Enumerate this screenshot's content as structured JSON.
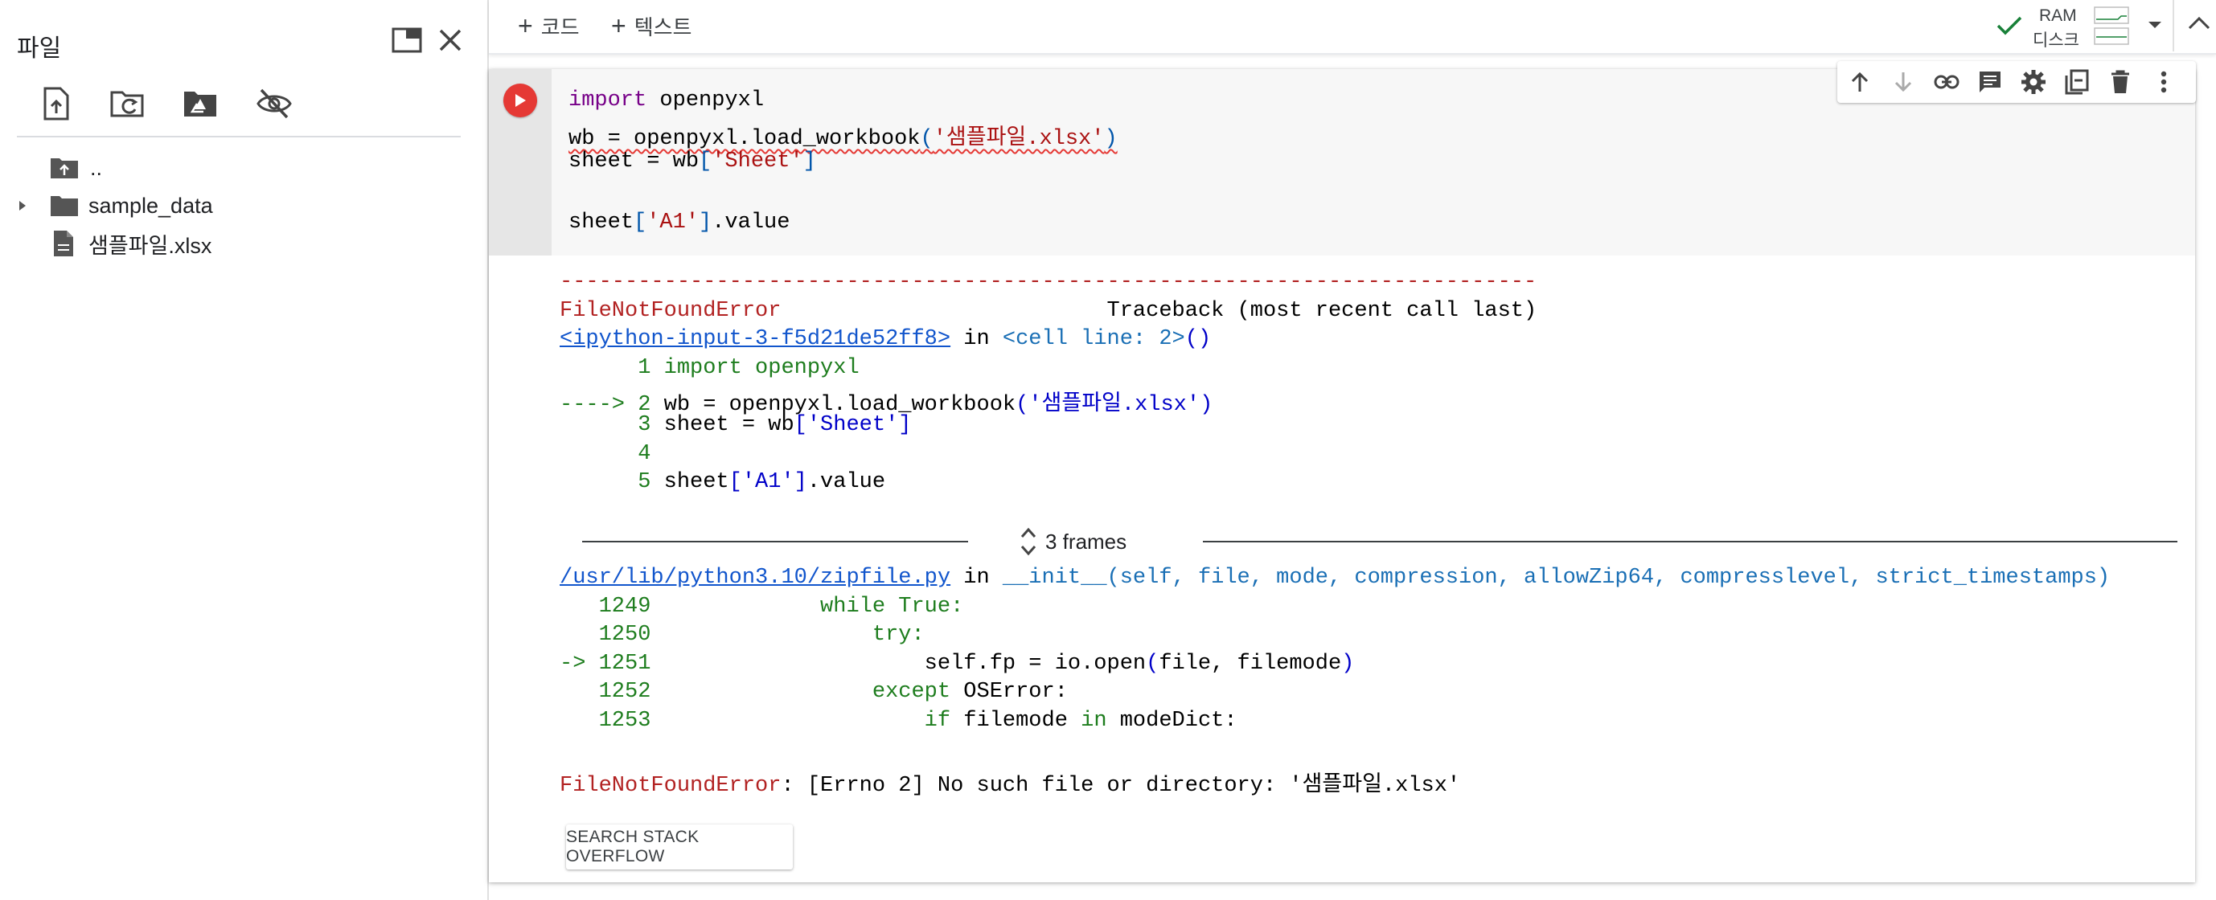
{
  "file_panel": {
    "title": "파일",
    "tree": {
      "parent": "..",
      "folder": "sample_data",
      "file": "샘플파일.xlsx"
    }
  },
  "topbar": {
    "add_code": "코드",
    "add_text": "텍스트",
    "ram_label": "RAM",
    "disk_label": "디스크"
  },
  "code": {
    "line1_kw": "import",
    "line1_rest": " openpyxl",
    "line2_a": "wb = openpyxl.load_workbook",
    "line2_b": "(",
    "line2_c": "'샘플파일.xlsx'",
    "line2_d": ")",
    "line3_a": "sheet = wb",
    "line3_b": "[",
    "line3_c": "'Sheet'",
    "line3_d": "]",
    "line5_a": "sheet",
    "line5_b": "[",
    "line5_c": "'A1'",
    "line5_d": "]",
    "line5_e": ".value"
  },
  "output": {
    "dashes": "---------------------------------------------------------------------------",
    "err_name": "FileNotFoundError",
    "traceback_header": "                         Traceback (most recent call last)",
    "input_link": "<ipython-input-3-f5d21de52ff8>",
    "in_word": " in ",
    "cell_line": "<cell line: 2>",
    "cell_paren": "()",
    "tb1_num": "      1 ",
    "tb1_code": "import openpyxl",
    "tb2_arrow": "----> 2 ",
    "tb2_code_a": "wb = openpyxl.load_workbook",
    "tb2_code_b": "(",
    "tb2_code_c": "'샘플파일.xlsx'",
    "tb2_code_d": ")",
    "tb3_num": "      3 ",
    "tb3_code_a": "sheet = wb",
    "tb3_code_b": "[",
    "tb3_code_c": "'Sheet'",
    "tb3_code_d": "]",
    "tb4_num": "      4",
    "tb5_num": "      5 ",
    "tb5_code_a": "sheet",
    "tb5_code_b": "[",
    "tb5_code_c": "'A1'",
    "tb5_code_d": "]",
    "tb5_code_e": ".value",
    "frames_label": "3 frames",
    "zip_link": "/usr/lib/python3.10/zipfile.py",
    "zip_in": " in ",
    "zip_func": "__init__(self, file, mode, compression, allowZip64, compresslevel, strict_timestamps)",
    "z1249_num": "   1249 ",
    "z1249_code": "            while True:",
    "z1250_num": "   1250 ",
    "z1250_code": "                try:",
    "z1251_num": "-> 1251 ",
    "z1251_code_a": "                    self.fp = io.open",
    "z1251_code_b": "(",
    "z1251_code_c": "file, filemode",
    "z1251_code_d": ")",
    "z1252_num": "   1252 ",
    "z1252_code_a": "                except",
    "z1252_code_b": " OSError:",
    "z1253_num": "   1253 ",
    "z1253_code_a": "                    if",
    "z1253_code_b": " filemode ",
    "z1253_code_c": "in",
    "z1253_code_d": " modeDict:",
    "final_err_name": "FileNotFoundError",
    "final_err_msg": ": [Errno 2] No such file or directory: '샘플파일.xlsx'",
    "so_button": "SEARCH STACK OVERFLOW"
  },
  "colors": {
    "run_button": "#e53935",
    "error_red": "#b22222",
    "link_blue": "#1155cc",
    "keyword_purple": "#770088",
    "ok_green": "#188038"
  },
  "icons": {
    "panel": [
      "new-window-icon",
      "close-icon"
    ],
    "tools": [
      "upload-file-icon",
      "refresh-folder-icon",
      "mount-drive-icon",
      "hide-files-icon"
    ],
    "cell_toolbar": [
      "arrow-up-icon",
      "arrow-down-icon",
      "link-icon",
      "comment-icon",
      "gear-icon",
      "mirror-cell-icon",
      "trash-icon",
      "more-vert-icon"
    ]
  }
}
